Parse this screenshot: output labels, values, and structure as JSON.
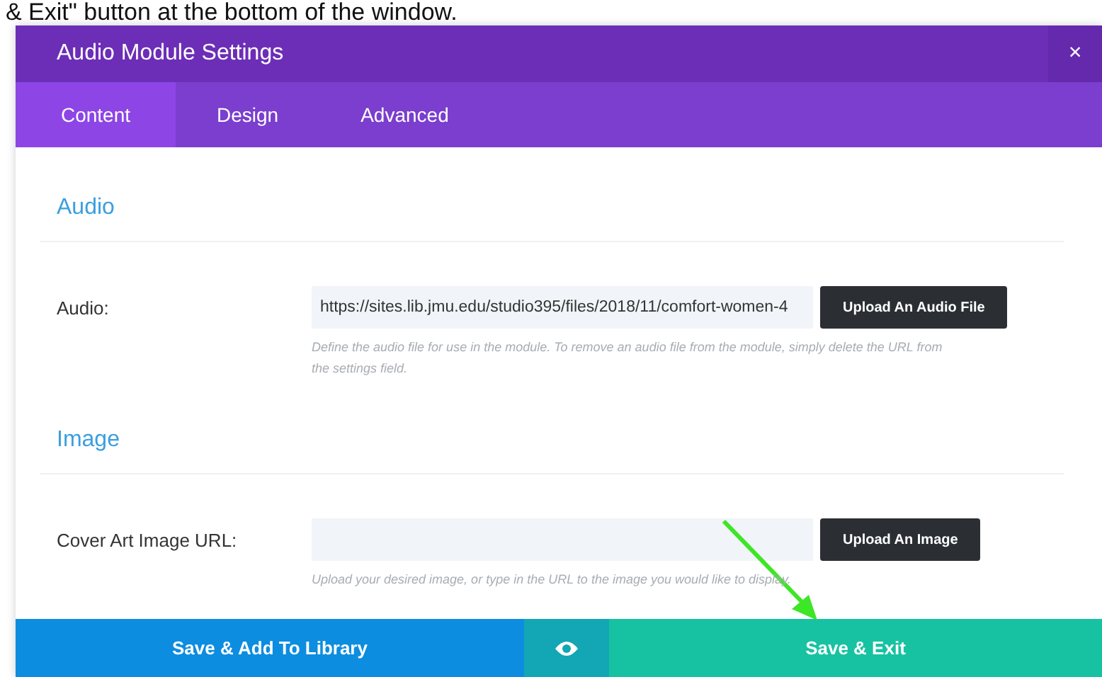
{
  "caption": "& Exit\" button at the bottom of the window.",
  "window": {
    "title": "Audio Module Settings",
    "close": "×"
  },
  "tabs": [
    {
      "label": "Content",
      "selected": true
    },
    {
      "label": "Design",
      "selected": false
    },
    {
      "label": "Advanced",
      "selected": false
    }
  ],
  "sections": [
    {
      "title": "Audio",
      "field": {
        "label": "Audio:",
        "value": "https://sites.lib.jmu.edu/studio395/files/2018/11/comfort-women-4",
        "button": "Upload An Audio File",
        "help": "Define the audio file for use in the module. To remove an audio file from the module, simply delete the URL from the settings field."
      }
    },
    {
      "title": "Image",
      "field": {
        "label": "Cover Art Image URL:",
        "button": "Upload An Image",
        "help": "Upload your desired image, or type in the URL to the image you would like to display."
      }
    }
  ],
  "footer": {
    "library_button": "Save & Add To Library",
    "exit_button": "Save & Exit"
  }
}
